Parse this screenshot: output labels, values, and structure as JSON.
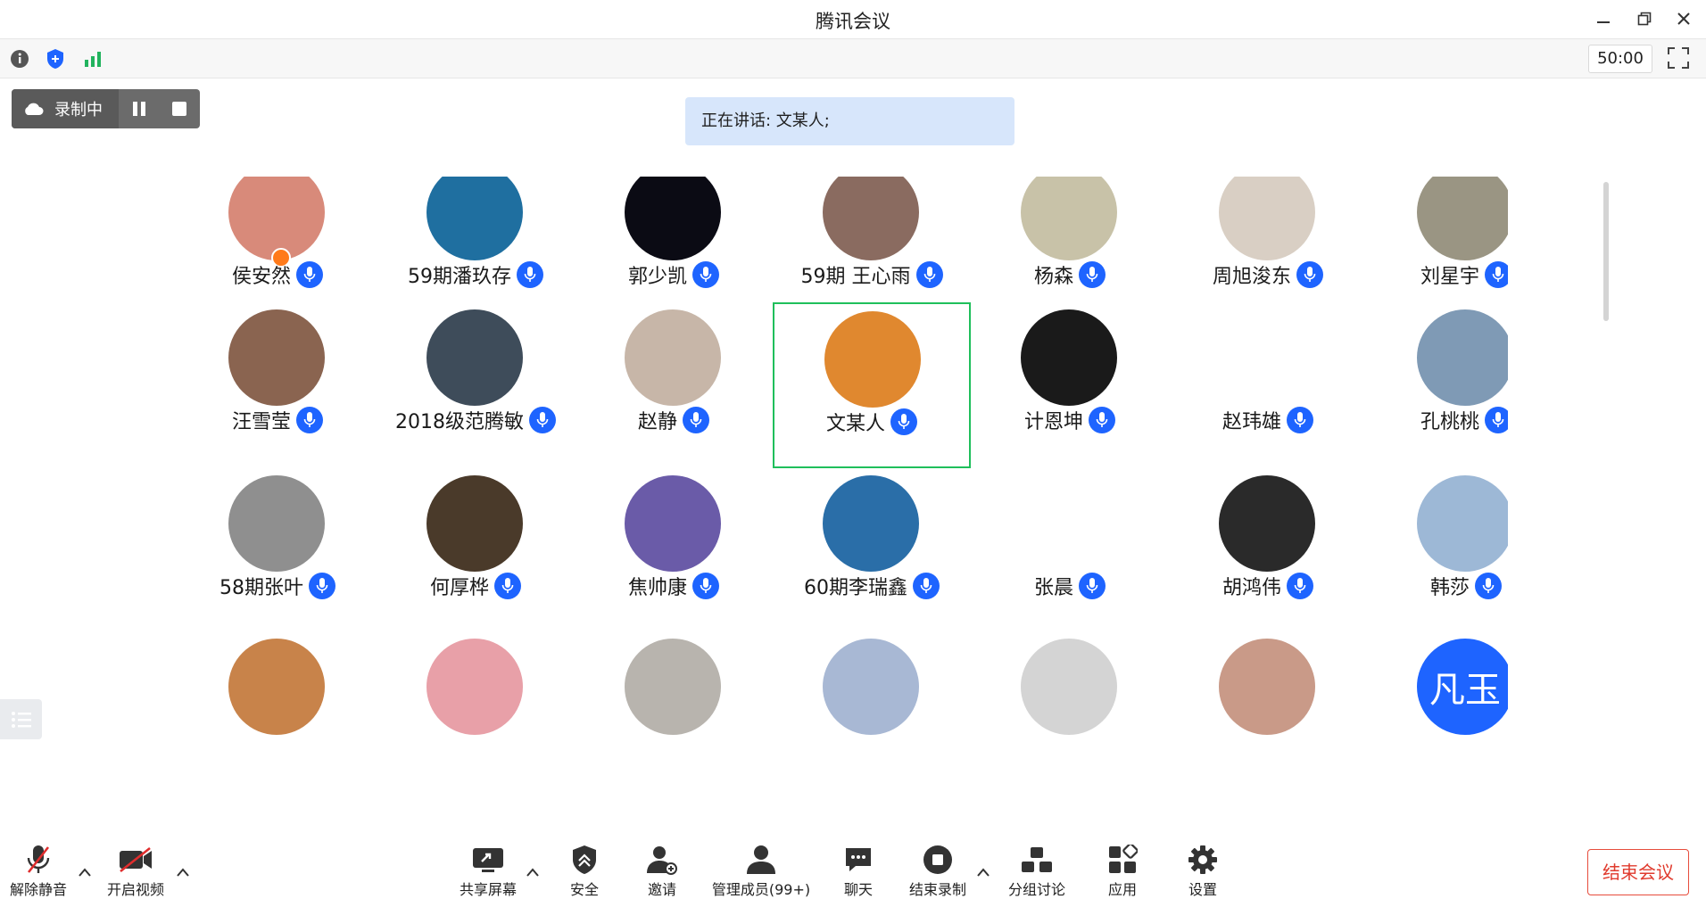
{
  "window": {
    "title": "腾讯会议"
  },
  "topbar": {
    "timer": "50:00"
  },
  "recording": {
    "label": "录制中"
  },
  "speaking": {
    "text": "正在讲话: 文某人;"
  },
  "participants": [
    {
      "name": "侯安然",
      "color": "#d88a7a",
      "host": true
    },
    {
      "name": "59期潘玖存",
      "color": "#1f6fa0"
    },
    {
      "name": "郭少凯",
      "color": "#0b0b14"
    },
    {
      "name": "59期 王心雨",
      "color": "#8a6b60"
    },
    {
      "name": "杨森",
      "color": "#c8c2a8"
    },
    {
      "name": "周旭浚东",
      "color": "#d9cfc4"
    },
    {
      "name": "刘星宇",
      "color": "#9a9583"
    },
    {
      "name": "汪雪莹",
      "color": "#8a6450"
    },
    {
      "name": "2018级范腾敏",
      "color": "#3e4c5a"
    },
    {
      "name": "赵静",
      "color": "#c7b6a8"
    },
    {
      "name": "文某人",
      "color": "#e0882f",
      "active": true
    },
    {
      "name": "计恩坤",
      "color": "#1a1a1a"
    },
    {
      "name": "赵玮雄",
      "color": "#ffffff"
    },
    {
      "name": "孔桃桃",
      "color": "#7f9ab5"
    },
    {
      "name": "58期张叶",
      "color": "#8f8f8f"
    },
    {
      "name": "何厚桦",
      "color": "#4a3a2a"
    },
    {
      "name": "焦帅康",
      "color": "#6a5ba8"
    },
    {
      "name": "60期李瑞鑫",
      "color": "#2a6ea8"
    },
    {
      "name": "张晨",
      "color": "#ffffff"
    },
    {
      "name": "胡鸿伟",
      "color": "#2a2a2a"
    },
    {
      "name": "韩莎",
      "color": "#9db8d6"
    },
    {
      "name": "",
      "color": "#c8834a"
    },
    {
      "name": "",
      "color": "#e8a0a8"
    },
    {
      "name": "",
      "color": "#b8b4ae"
    },
    {
      "name": "",
      "color": "#a8b8d4"
    },
    {
      "name": "",
      "color": "#d4d4d4"
    },
    {
      "name": "",
      "color": "#c99a88"
    },
    {
      "name": "",
      "color": "#1e64ff",
      "text": "凡玉"
    }
  ],
  "bottombar": {
    "unmute": "解除静音",
    "video": "开启视频",
    "share": "共享屏幕",
    "security": "安全",
    "invite": "邀请",
    "members": "管理成员(99+)",
    "chat": "聊天",
    "stoprec": "结束录制",
    "breakout": "分组讨论",
    "apps": "应用",
    "settings": "设置",
    "end": "结束会议"
  }
}
